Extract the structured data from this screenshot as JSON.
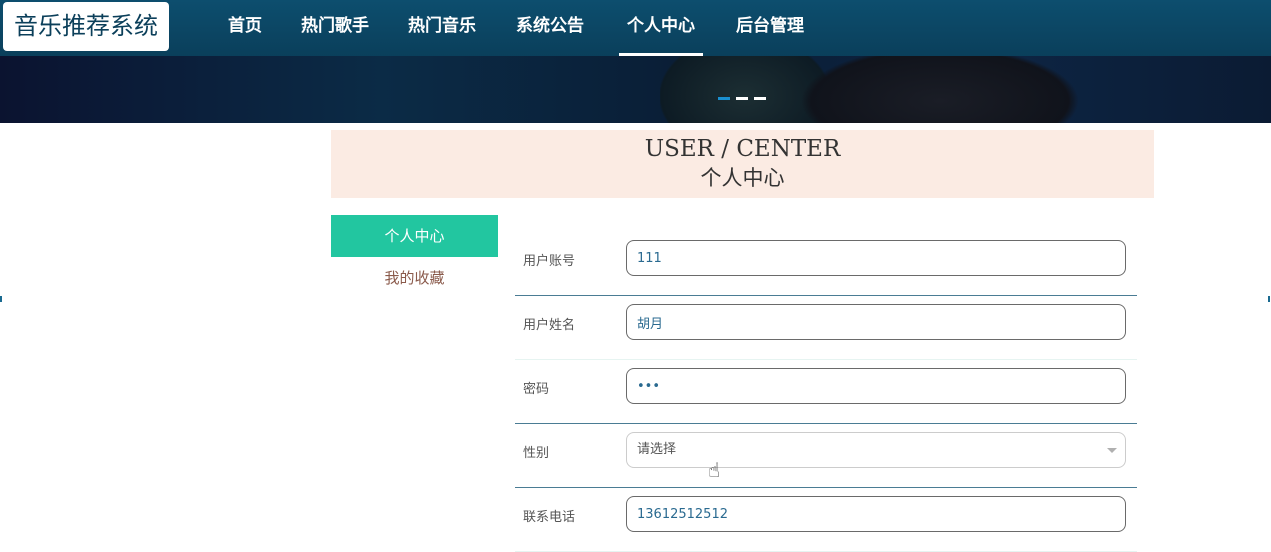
{
  "app": {
    "logo": "音乐推荐系统"
  },
  "nav": {
    "items": [
      {
        "label": "首页"
      },
      {
        "label": "热门歌手"
      },
      {
        "label": "热门音乐"
      },
      {
        "label": "系统公告"
      },
      {
        "label": "个人中心",
        "active": true
      },
      {
        "label": "后台管理"
      }
    ]
  },
  "banner": {
    "slides": 3,
    "active_slide": 1
  },
  "center": {
    "title_en": "USER / CENTER",
    "title_cn": "个人中心"
  },
  "sidebar": {
    "items": [
      {
        "label": "个人中心",
        "active": true
      },
      {
        "label": "我的收藏"
      }
    ]
  },
  "form": {
    "fields": [
      {
        "label": "用户账号",
        "value": "111",
        "type": "text"
      },
      {
        "label": "用户姓名",
        "value": "胡月",
        "type": "text"
      },
      {
        "label": "密码",
        "value": "111",
        "type": "password"
      },
      {
        "label": "性别",
        "value": "请选择",
        "type": "select"
      },
      {
        "label": "联系电话",
        "value": "13612512512",
        "type": "text"
      }
    ]
  },
  "colors": {
    "nav_bg": "#0a3f5b",
    "accent": "#22c6a0",
    "title_bg": "#fbebe3"
  }
}
